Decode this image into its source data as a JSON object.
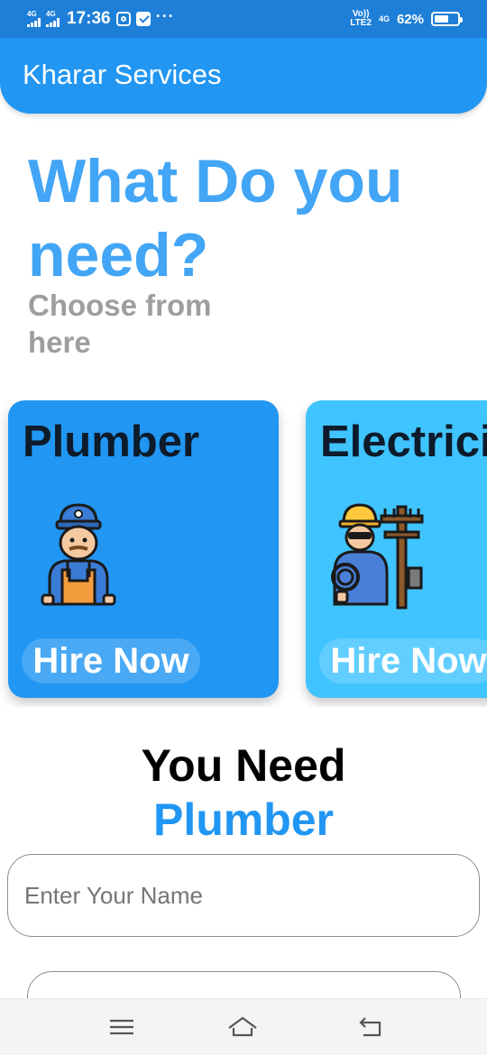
{
  "status_bar": {
    "sim1_network": "4G",
    "sim2_network": "4G",
    "time": "17:36",
    "overflow": "···",
    "volte_top": "Vo))",
    "volte_bottom": "LTE2",
    "data_network": "4G",
    "battery_percent": "62%",
    "battery_level": 0.62,
    "icons": [
      "signal-icon",
      "instagram-icon",
      "mail-icon",
      "battery-icon"
    ]
  },
  "app_bar": {
    "title": "Kharar Services"
  },
  "heading": {
    "title": "What Do you need?",
    "subtitle": "Choose from here"
  },
  "services": [
    {
      "name": "Plumber",
      "button": "Hire Now",
      "icon": "plumber-icon",
      "color": "#2196f3"
    },
    {
      "name": "Electrician",
      "button": "Hire Now",
      "icon": "electrician-icon",
      "color": "#40c4ff"
    }
  ],
  "selection": {
    "label": "You Need",
    "service": "Plumber"
  },
  "form": {
    "name_placeholder": "Enter Your Name",
    "name_value": ""
  },
  "nav": {
    "icons": [
      "menu-icon",
      "home-icon",
      "back-icon"
    ]
  },
  "colors": {
    "primary": "#2196f3",
    "status_bar": "#1e7fd8",
    "heading": "#42a5f5",
    "subtitle": "#9e9e9e"
  }
}
